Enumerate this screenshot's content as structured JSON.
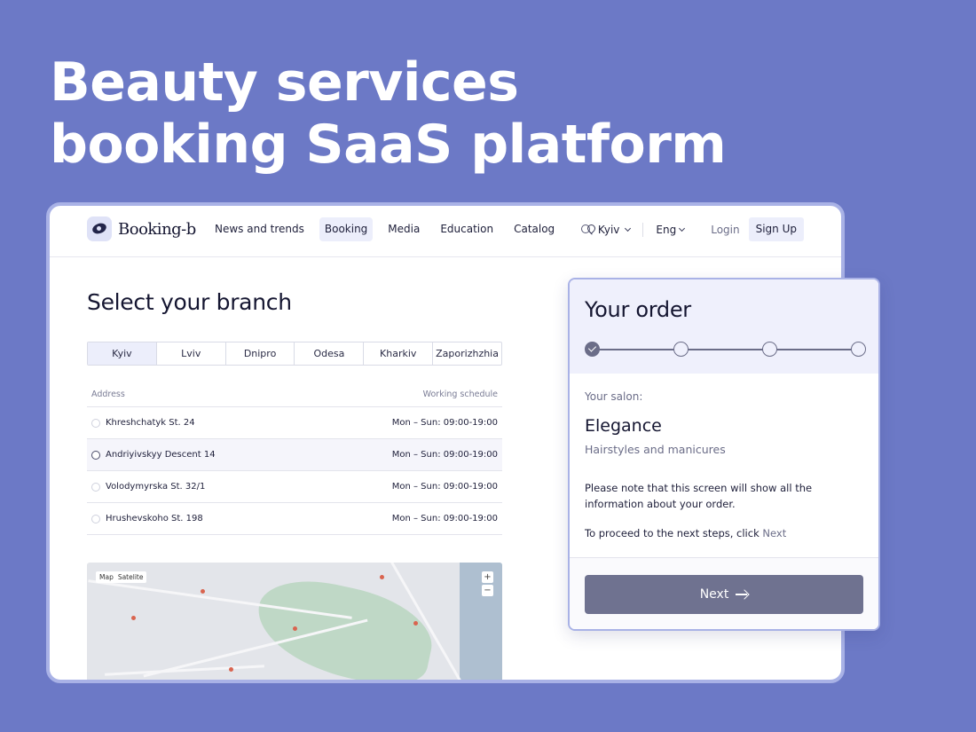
{
  "hero": {
    "line1": "Beauty services",
    "line2": "booking SaaS platform"
  },
  "header": {
    "logo_text": "Booking-b",
    "nav": [
      "News and trends",
      "Booking",
      "Media",
      "Education",
      "Catalog"
    ],
    "active_nav": "Booking",
    "city": "Kyiv",
    "language": "Eng",
    "login_label": "Login",
    "signup_label": "Sign Up"
  },
  "branch": {
    "title": "Select your branch",
    "cities": [
      "Kyiv",
      "Lviv",
      "Dnipro",
      "Odesa",
      "Kharkiv",
      "Zaporizhzhia"
    ],
    "active_city": "Kyiv",
    "columns": {
      "address": "Address",
      "schedule": "Working schedule"
    },
    "rows": [
      {
        "address": "Khreshchatyk St. 24",
        "schedule": "Mon – Sun: 09:00-19:00"
      },
      {
        "address": "Andriyivskyy Descent 14",
        "schedule": "Mon – Sun: 09:00-19:00"
      },
      {
        "address": "Volodymyrska St. 32/1",
        "schedule": "Mon – Sun: 09:00-19:00"
      },
      {
        "address": "Hrushevskoho St. 198",
        "schedule": "Mon – Sun: 09:00-19:00"
      }
    ]
  },
  "map": {
    "map_label": "Map",
    "satellite_label": "Satelite",
    "zoom_in": "+",
    "zoom_out": "−"
  },
  "order": {
    "title": "Your order",
    "steps_total": 4,
    "steps_completed": 1,
    "salon_label": "Your salon:",
    "salon_name": "Elegance",
    "salon_desc": "Hairstyles and manicures",
    "note": "Please note that this screen will show all the information about your order.",
    "hint_prefix": "To proceed to the next steps, click",
    "hint_next": "Next",
    "next_button": "Next"
  },
  "colors": {
    "background": "#6c79c6",
    "accent_light": "#eceefb",
    "button": "#6f7290",
    "text_dark": "#151631",
    "text_muted": "#6b6d88"
  }
}
